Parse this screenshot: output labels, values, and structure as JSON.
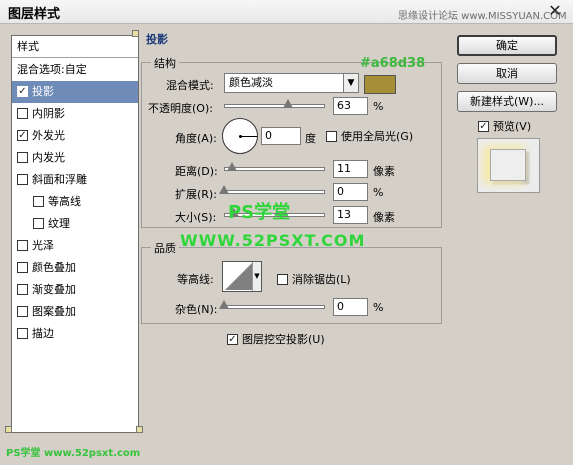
{
  "window": {
    "title": "图层样式",
    "watermark_site": "思缘设计论坛 www.MISSYUAN.COM",
    "close_glyph": "✕"
  },
  "style_list": {
    "header": "样式",
    "items": [
      {
        "label": "混合选项:自定",
        "checkbox": false,
        "checked": false,
        "sub": false,
        "selected": false
      },
      {
        "label": "投影",
        "checkbox": true,
        "checked": true,
        "sub": false,
        "selected": true
      },
      {
        "label": "内阴影",
        "checkbox": true,
        "checked": false,
        "sub": false,
        "selected": false
      },
      {
        "label": "外发光",
        "checkbox": true,
        "checked": true,
        "sub": false,
        "selected": false
      },
      {
        "label": "内发光",
        "checkbox": true,
        "checked": false,
        "sub": false,
        "selected": false
      },
      {
        "label": "斜面和浮雕",
        "checkbox": true,
        "checked": false,
        "sub": false,
        "selected": false
      },
      {
        "label": "等高线",
        "checkbox": true,
        "checked": false,
        "sub": true,
        "selected": false
      },
      {
        "label": "纹理",
        "checkbox": true,
        "checked": false,
        "sub": true,
        "selected": false
      },
      {
        "label": "光泽",
        "checkbox": true,
        "checked": false,
        "sub": false,
        "selected": false
      },
      {
        "label": "颜色叠加",
        "checkbox": true,
        "checked": false,
        "sub": false,
        "selected": false
      },
      {
        "label": "渐变叠加",
        "checkbox": true,
        "checked": false,
        "sub": false,
        "selected": false
      },
      {
        "label": "图案叠加",
        "checkbox": true,
        "checked": false,
        "sub": false,
        "selected": false
      },
      {
        "label": "描边",
        "checkbox": true,
        "checked": false,
        "sub": false,
        "selected": false
      }
    ]
  },
  "drop_shadow": {
    "title": "投影",
    "structure_title": "结构",
    "color_hex_label": "#a68d38",
    "color": "#a68d38",
    "blend_mode_label": "混合模式:",
    "blend_mode_value": "颜色减淡",
    "opacity_label": "不透明度(O):",
    "opacity_value": "63",
    "opacity_unit": "%",
    "opacity_fraction": 0.63,
    "angle_label": "角度(A):",
    "angle_value": "0",
    "angle_unit": "度",
    "global_light_label": "使用全局光(G)",
    "global_light_checked": false,
    "distance_label": "距离(D):",
    "distance_value": "11",
    "distance_unit": "像素",
    "distance_fraction": 0.08,
    "spread_label": "扩展(R):",
    "spread_value": "0",
    "spread_unit": "%",
    "spread_fraction": 0.0,
    "size_label": "大小(S):",
    "size_value": "13",
    "size_unit": "像素",
    "size_fraction": 0.1,
    "quality_title": "品质",
    "contour_label": "等高线:",
    "anti_alias_label": "消除锯齿(L)",
    "anti_alias_checked": false,
    "noise_label": "杂色(N):",
    "noise_value": "0",
    "noise_unit": "%",
    "noise_fraction": 0.0,
    "knockout_label": "图层挖空投影(U)",
    "knockout_checked": true
  },
  "overlay_watermark": {
    "ps": "PS学堂",
    "url": "WWW.52PSXT.COM",
    "bottom_left": "PS学堂 www.52psxt.com"
  },
  "buttons": {
    "ok": "确定",
    "cancel": "取消",
    "new_style": "新建样式(W)...",
    "preview_label": "预览(V)",
    "preview_checked": true
  },
  "check_glyph": "✓"
}
